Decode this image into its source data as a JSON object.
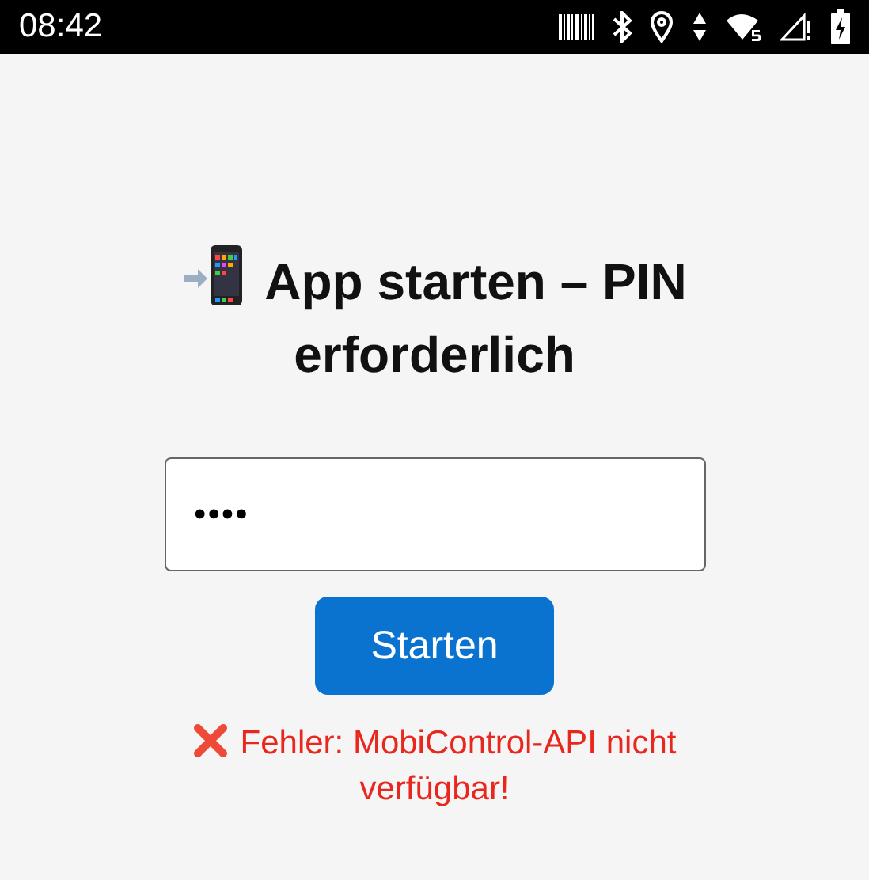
{
  "status_bar": {
    "time": "08:42"
  },
  "title": "App starten – PIN erforderlich",
  "pin_field": {
    "value": "••••"
  },
  "start_button": {
    "label": "Starten"
  },
  "error": {
    "text": "Fehler: MobiControl-API nicht verfügbar!"
  }
}
